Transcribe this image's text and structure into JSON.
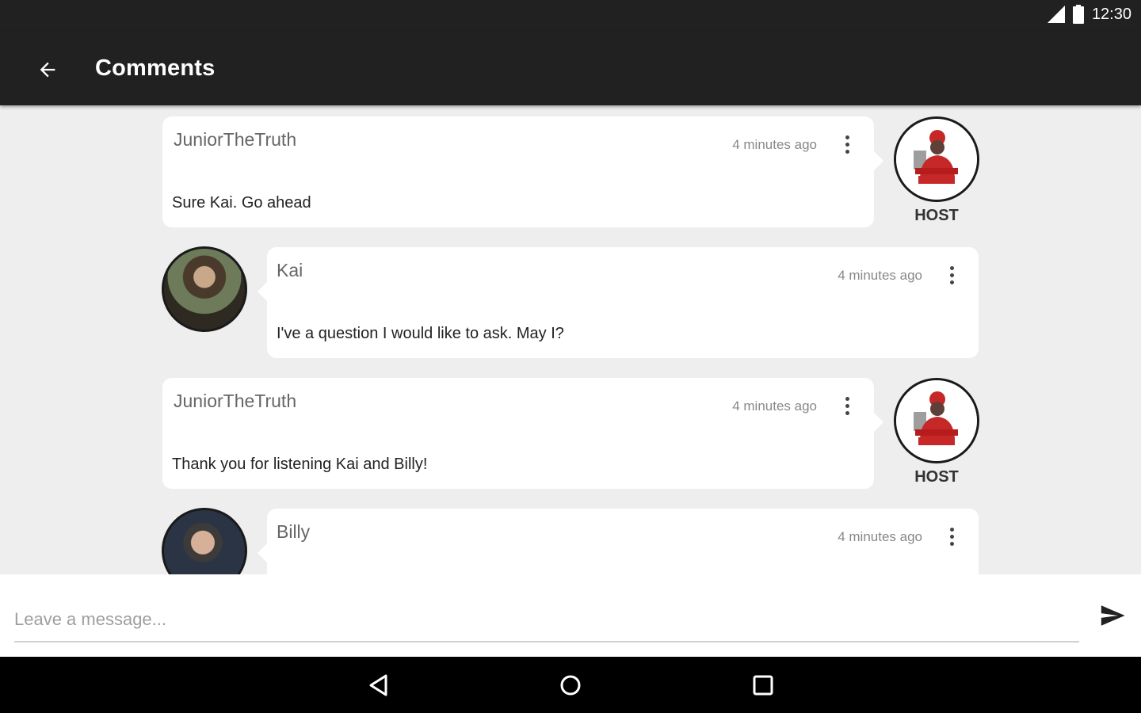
{
  "status_bar": {
    "time": "12:30",
    "icons": [
      "signal-icon",
      "battery-icon"
    ]
  },
  "app_bar": {
    "title": "Comments",
    "back_icon": "arrow-back-icon"
  },
  "comments": [
    {
      "author": "JuniorTheTruth",
      "time": "4 minutes ago",
      "text": "Sure Kai. Go ahead",
      "role": "HOST"
    },
    {
      "author": "Kai",
      "time": "4 minutes ago",
      "text": "I've a question I would like to ask. May I?"
    },
    {
      "author": "JuniorTheTruth",
      "time": "4 minutes ago",
      "text": "Thank you for listening Kai and Billy!",
      "role": "HOST"
    },
    {
      "author": "Billy",
      "time": "4 minutes ago",
      "text": ""
    }
  ],
  "composer": {
    "placeholder": "Leave a message...",
    "send_icon": "send-icon"
  },
  "nav_bar": {
    "icons": [
      "nav-back-icon",
      "nav-home-icon",
      "nav-recents-icon"
    ]
  },
  "colors": {
    "bar": "#212121",
    "background": "#eeeeee",
    "host_red": "#c62828"
  }
}
